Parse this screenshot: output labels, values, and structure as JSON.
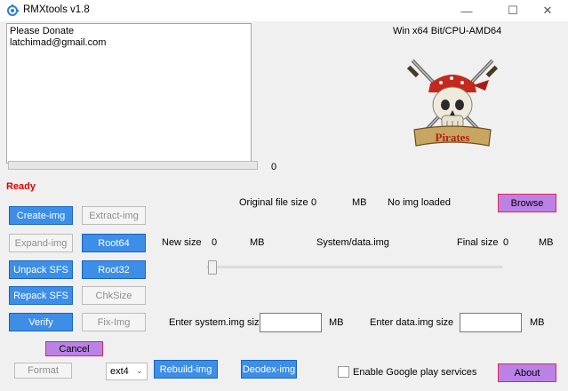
{
  "window": {
    "title": "RMXtools v1.8",
    "minimize": "—",
    "maximize": "☐",
    "close": "✕"
  },
  "log_lines": [
    "Please Donate",
    "latchimad@gmail.com"
  ],
  "os_info": "Win x64 Bit/CPU-AMD64",
  "logo_icon": "pirates-skull-logo",
  "progress": {
    "fraction": 0,
    "value_text": "0"
  },
  "status": "Ready",
  "original": {
    "label": "Original file size",
    "value": "0",
    "unit": "MB",
    "img_status": "No img loaded"
  },
  "buttons": {
    "create_img": "Create-img",
    "extract_img": "Extract-img",
    "expand_img": "Expand-img",
    "root64": "Root64",
    "unpack_sfs": "Unpack SFS",
    "root32": "Root32",
    "repack_sfs": "Repack SFS",
    "chksize": "ChkSize",
    "verify": "Verify",
    "fix_img": "Fix-Img",
    "cancel": "Cancel",
    "format": "Format",
    "rebuild_img": "Rebuild-img",
    "deodex_img": "Deodex-img",
    "browse": "Browse",
    "about": "About"
  },
  "sizes": {
    "new_size_label": "New size",
    "new_size_value": "0",
    "new_size_unit": "MB",
    "image_label": "System/data.img",
    "final_size_label": "Final size",
    "final_size_value": "0",
    "final_size_unit": "MB"
  },
  "slider": {
    "fraction": 0
  },
  "inputs": {
    "system_label": "Enter system.img size",
    "system_value": "",
    "system_unit": "MB",
    "data_label": "Enter data.img size",
    "data_value": "",
    "data_unit": "MB"
  },
  "filesystem": {
    "selected": "ext4"
  },
  "google_play": {
    "label": "Enable Google play services",
    "checked": false
  },
  "colors": {
    "button_blue": "#3c8ee6",
    "button_purple": "#bb82e6",
    "status_red": "#e00000",
    "progress_green": "#06b025"
  }
}
